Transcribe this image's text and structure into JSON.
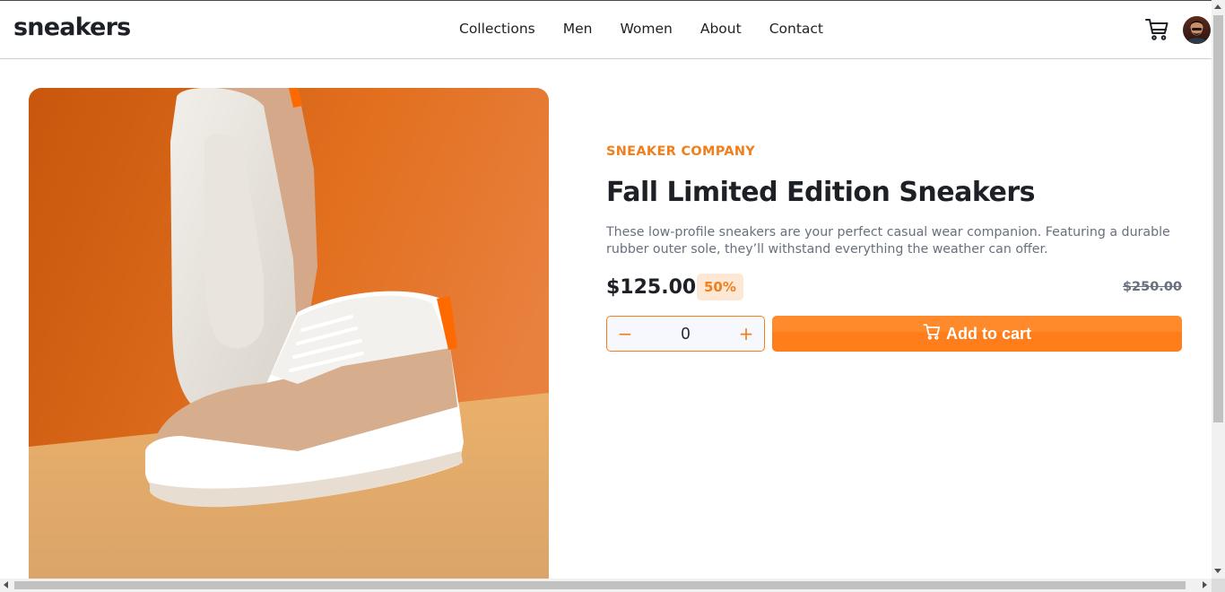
{
  "header": {
    "logo": "sneakers",
    "nav": [
      "Collections",
      "Men",
      "Women",
      "About",
      "Contact"
    ],
    "cart_icon": "cart-icon",
    "avatar_icon": "user-avatar"
  },
  "product": {
    "image_alt": "sneaker-photo",
    "company": "SNEAKER COMPANY",
    "title": "Fall Limited Edition Sneakers",
    "description_line1": "These low-profile sneakers are your perfect casual wear companion. Featuring a durable",
    "description_line2": "rubber outer sole, they’ll withstand everything the weather can offer.",
    "price": "$125.00",
    "discount": "50%",
    "original_price": "$250.00"
  },
  "quantity": {
    "minus": "−",
    "value": "0",
    "plus": "+"
  },
  "cart_button": {
    "label": "Add to cart",
    "icon": "cart-icon"
  },
  "colors": {
    "accent": "#f07f1c",
    "accent_light": "#fde8d5",
    "text_dark": "#1d2025",
    "text_muted": "#68707d"
  }
}
